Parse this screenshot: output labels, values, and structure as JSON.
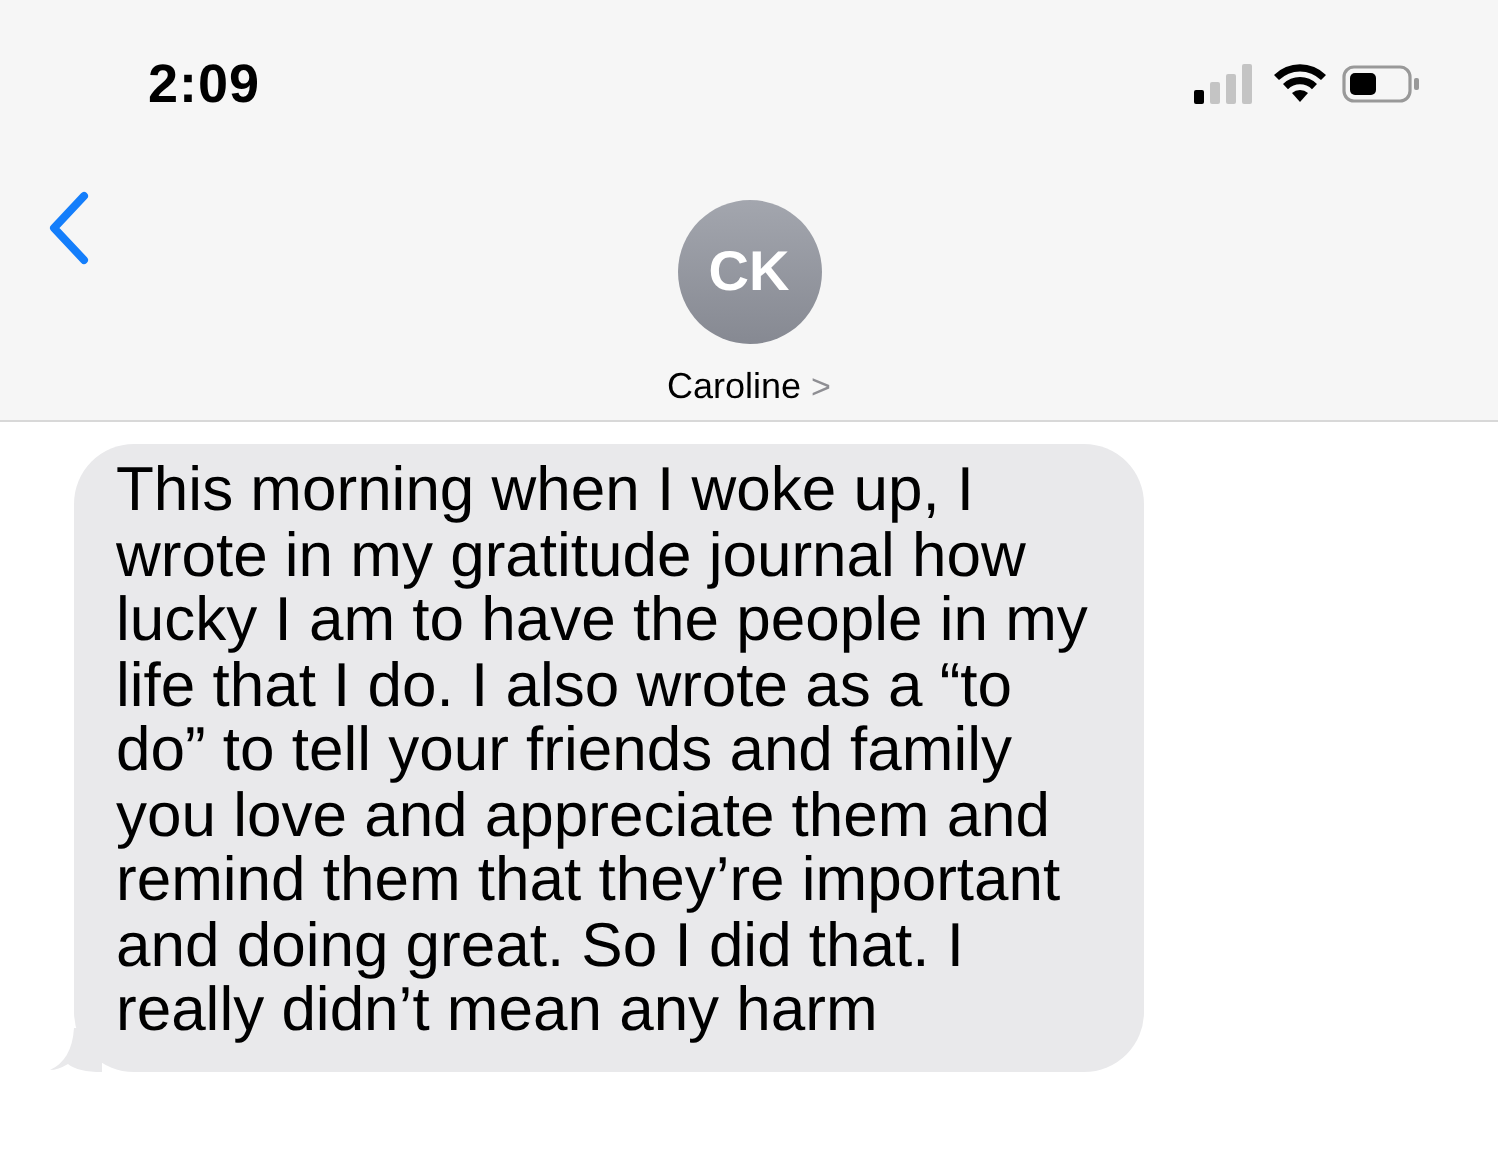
{
  "status_bar": {
    "time": "2:09"
  },
  "contact": {
    "initials": "CK",
    "name": "Caroline",
    "chevron": ">"
  },
  "messages": [
    {
      "kind": "received",
      "text": "This morning when I woke up, I wrote in my gratitude journal how lucky I am to have the people in my life that I do. I also wrote as a “to do” to tell your friends and family you love and appreciate them and remind them that they’re important and doing great. So I did that. I really didn’t mean any harm"
    }
  ]
}
